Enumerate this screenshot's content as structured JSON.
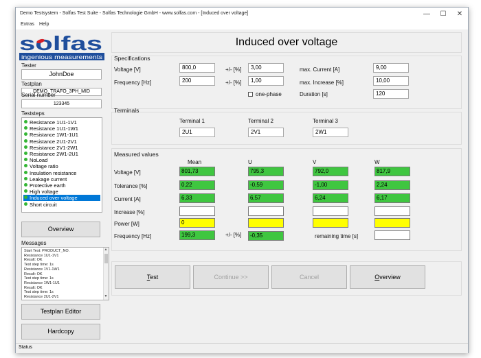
{
  "window": {
    "title": "Demo Testsystem - Solfas Test Suite - Solfas Technologie GmbH - www.solfas.com - [Induced over voltage]"
  },
  "window_controls": {
    "minimize": "—",
    "maximize": "☐",
    "close": "✕"
  },
  "menu": [
    "Extras",
    "Help"
  ],
  "logo": {
    "text": "solfas",
    "tagline": "ingenious measurements",
    "brand_color": "#1f4e9c",
    "accent_color": "#d42028"
  },
  "sidebar": {
    "tester_label": "Tester",
    "tester_value": "JohnDoe",
    "testplan_label": "Testplan",
    "testplan_value": "DEMO_TRAFO_3PH_MID",
    "serial_label": "Serial number",
    "serial_value": "123345",
    "teststeps_label": "Teststeps",
    "teststeps": [
      "Resistance 1U1-1V1",
      "Resistance 1U1-1W1",
      "Resistance 1W1-1U1",
      "Resistance 2U1-2V1",
      "Resistance 2V1-2W1",
      "Resistance 2W1-2U1",
      "NoLoad",
      "Voltage ratio",
      "Insulation resistance",
      "Leakage current",
      "Protective earth",
      "High voltage",
      "Induced over voltage",
      "Short circuit"
    ],
    "selected_step": "Induced over voltage",
    "overview_button": "Overview",
    "messages_label": "Messages",
    "messages": [
      "Start Test: PRODUCT_NO.",
      "Resistance 1U1-1V1",
      "Result: OK",
      "Test step time: 1s",
      "Resistance 1V1-1W1",
      "Result: OK",
      "Test step time: 1s",
      "Resistance 1W1-1U1",
      "Result: OK",
      "Test step time: 1s",
      "Resistance 2U1-2V1"
    ],
    "testplan_editor_button": "Testplan Editor",
    "hardcopy_button": "Hardcopy"
  },
  "main": {
    "title": "Induced over voltage",
    "specifications": {
      "heading": "Specifications",
      "voltage_label": "Voltage [V]",
      "voltage_value": "800,0",
      "voltage_tol_label": "+/- [%]",
      "voltage_tol_value": "3,00",
      "max_current_label": "max. Current [A]",
      "max_current_value": "9,00",
      "frequency_label": "Frequency [Hz]",
      "frequency_value": "200",
      "frequency_tol_label": "+/- [%]",
      "frequency_tol_value": "1,00",
      "max_increase_label": "max. Increase [%]",
      "max_increase_value": "10,00",
      "one_phase_label": "one-phase",
      "one_phase_checked": false,
      "duration_label": "Duration [s]",
      "duration_value": "120"
    },
    "terminals": {
      "heading": "Terminals",
      "items": [
        {
          "label": "Terminal 1",
          "value": "2U1"
        },
        {
          "label": "Terminal 2",
          "value": "2V1"
        },
        {
          "label": "Terminal 3",
          "value": "2W1"
        }
      ]
    },
    "measured": {
      "heading": "Measured values",
      "columns": [
        "Mean",
        "U",
        "V",
        "W"
      ],
      "rows": [
        {
          "label": "Voltage [V]",
          "values": [
            "801,73",
            "795,3",
            "792,0",
            "817,9"
          ],
          "state": "green"
        },
        {
          "label": "Tolerance [%]",
          "values": [
            "0,22",
            "-0,59",
            "-1,00",
            "2,24"
          ],
          "state": "green"
        },
        {
          "label": "Current [A]",
          "values": [
            "6,33",
            "6,57",
            "6,24",
            "6,17"
          ],
          "state": "green"
        },
        {
          "label": "Increase [%]",
          "values": [
            "",
            "",
            "",
            ""
          ],
          "state": "white"
        },
        {
          "label": "Power [W]",
          "values": [
            "0",
            "",
            "",
            ""
          ],
          "state": "yellow"
        }
      ],
      "frequency_label": "Frequency [Hz]",
      "frequency_value": "199,3",
      "frequency_tol_label": "+/- [%]",
      "frequency_tol_value": "-0,35",
      "remaining_label": "remaining time [s]",
      "remaining_value": ""
    },
    "buttons": {
      "test_prefix": "",
      "test_mnemonic": "T",
      "test_rest": "est",
      "continue": "Continue >>",
      "cancel": "Cancel",
      "overview_mnemonic": "O",
      "overview_rest": "verview"
    }
  },
  "statusbar": {
    "text": "Status"
  },
  "colors": {
    "pass": "#3fc640",
    "pending": "#ffff00",
    "selection": "#0078d7",
    "step_dot": "#34b534"
  }
}
